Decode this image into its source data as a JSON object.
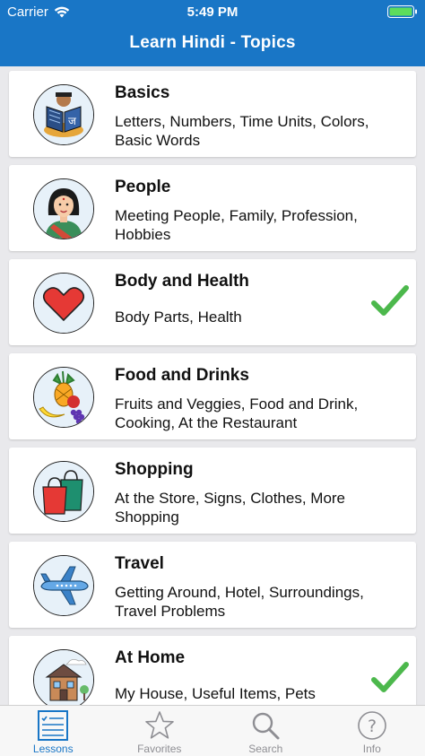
{
  "status_bar": {
    "carrier": "Carrier",
    "time": "5:49 PM"
  },
  "nav": {
    "title": "Learn Hindi - Topics"
  },
  "topics": [
    {
      "title": "Basics",
      "subtitle": "Letters, Numbers, Time Units, Colors, Basic Words",
      "icon": "book-reader-icon",
      "completed": false
    },
    {
      "title": "People",
      "subtitle": "Meeting People, Family, Profession, Hobbies",
      "icon": "woman-icon",
      "completed": false
    },
    {
      "title": "Body and Health",
      "subtitle": "Body Parts, Health",
      "icon": "heart-icon",
      "completed": true
    },
    {
      "title": "Food and Drinks",
      "subtitle": "Fruits and Veggies, Food and Drink, Cooking, At the Restaurant",
      "icon": "fruit-icon",
      "completed": false
    },
    {
      "title": "Shopping",
      "subtitle": "At the Store, Signs, Clothes, More Shopping",
      "icon": "shopping-bags-icon",
      "completed": false
    },
    {
      "title": "Travel",
      "subtitle": "Getting Around, Hotel, Surroundings, Travel Problems",
      "icon": "airplane-icon",
      "completed": false
    },
    {
      "title": "At Home",
      "subtitle": "My House, Useful Items, Pets",
      "icon": "house-icon",
      "completed": true
    }
  ],
  "tabs": [
    {
      "label": "Lessons",
      "icon": "lessons-list-icon",
      "active": true
    },
    {
      "label": "Favorites",
      "icon": "star-icon",
      "active": false
    },
    {
      "label": "Search",
      "icon": "search-icon",
      "active": false
    },
    {
      "label": "Info",
      "icon": "info-icon",
      "active": false
    }
  ],
  "colors": {
    "header": "#1976c6",
    "check": "#4cb84c",
    "tab_active": "#1976c6",
    "tab_inactive": "#8e8e93"
  }
}
